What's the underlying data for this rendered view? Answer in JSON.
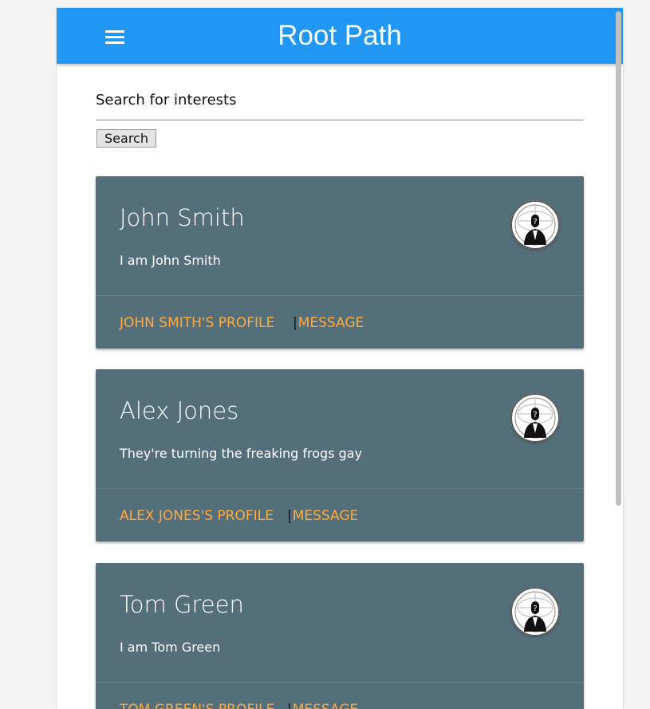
{
  "header": {
    "title": "Root Path",
    "menu_icon": "hamburger-menu-icon",
    "color": "#2196f3"
  },
  "search": {
    "label": "Search for interests",
    "value": "",
    "placeholder": "",
    "button_label": "Search"
  },
  "card_colors": {
    "background": "#546e7a",
    "link": "#ffab40"
  },
  "users": [
    {
      "name": "John Smith",
      "bio": "I am John Smith",
      "avatar_icon": "anonymous-mask-avatar-icon",
      "profile_label": "JOHN SMITH'S PROFILE",
      "separator": "|",
      "message_label": "MESSAGE"
    },
    {
      "name": "Alex Jones",
      "bio": "They're turning the freaking frogs gay",
      "avatar_icon": "anonymous-mask-avatar-icon",
      "profile_label": "ALEX JONES'S PROFILE",
      "separator": "|",
      "message_label": "MESSAGE"
    },
    {
      "name": "Tom Green",
      "bio": "I am Tom Green",
      "avatar_icon": "anonymous-mask-avatar-icon",
      "profile_label": "TOM GREEN'S PROFILE",
      "separator": "|",
      "message_label": "MESSAGE"
    }
  ]
}
